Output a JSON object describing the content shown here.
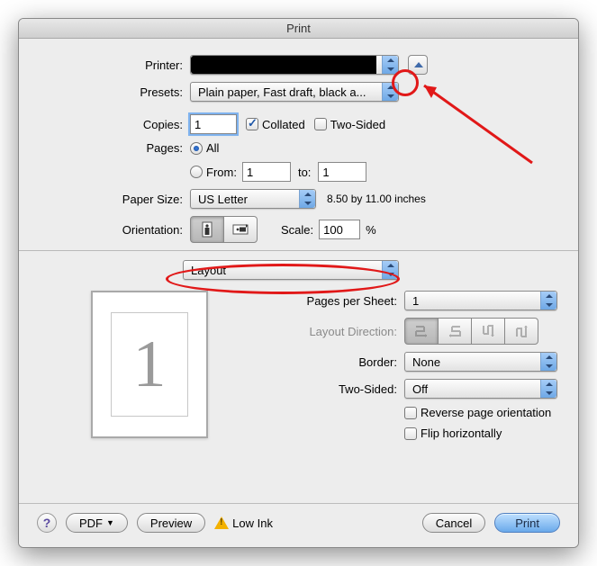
{
  "window": {
    "title": "Print"
  },
  "printer": {
    "label": "Printer:",
    "value": ""
  },
  "presets": {
    "label": "Presets:",
    "value": "Plain paper, Fast draft, black a..."
  },
  "copies": {
    "label": "Copies:",
    "value": "1",
    "collated": {
      "label": "Collated",
      "checked": true
    },
    "two_sided": {
      "label": "Two-Sided",
      "checked": false
    }
  },
  "pages": {
    "label": "Pages:",
    "all": {
      "label": "All",
      "checked": true
    },
    "range": {
      "label": "From:",
      "from": "1",
      "to_label": "to:",
      "to": "1",
      "checked": false
    }
  },
  "paper_size": {
    "label": "Paper Size:",
    "value": "US Letter",
    "dims": "8.50 by 11.00 inches"
  },
  "orientation": {
    "label": "Orientation:",
    "scale_label": "Scale:",
    "scale_value": "100",
    "scale_unit": "%"
  },
  "section_popup": {
    "value": "Layout"
  },
  "layout": {
    "pages_per_sheet": {
      "label": "Pages per Sheet:",
      "value": "1"
    },
    "layout_direction": {
      "label": "Layout Direction:"
    },
    "border": {
      "label": "Border:",
      "value": "None"
    },
    "two_sided": {
      "label": "Two-Sided:",
      "value": "Off"
    },
    "reverse": {
      "label": "Reverse page orientation",
      "checked": false
    },
    "flip": {
      "label": "Flip horizontally",
      "checked": false
    }
  },
  "preview": {
    "page_number": "1"
  },
  "footer": {
    "pdf": "PDF",
    "preview": "Preview",
    "low_ink": "Low Ink",
    "cancel": "Cancel",
    "print": "Print",
    "help": "?"
  }
}
